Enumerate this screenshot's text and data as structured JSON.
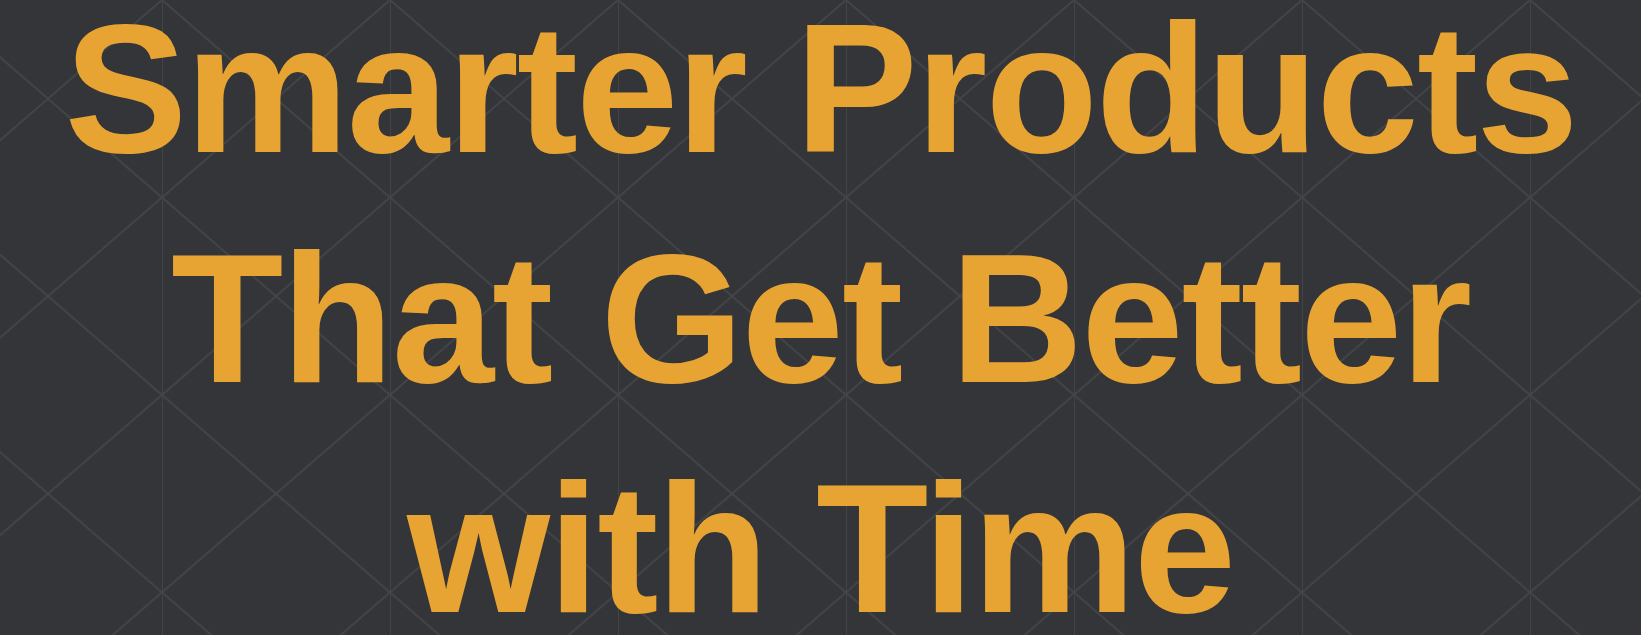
{
  "hero": {
    "title": "Smarter Products That Get Better with Time"
  }
}
